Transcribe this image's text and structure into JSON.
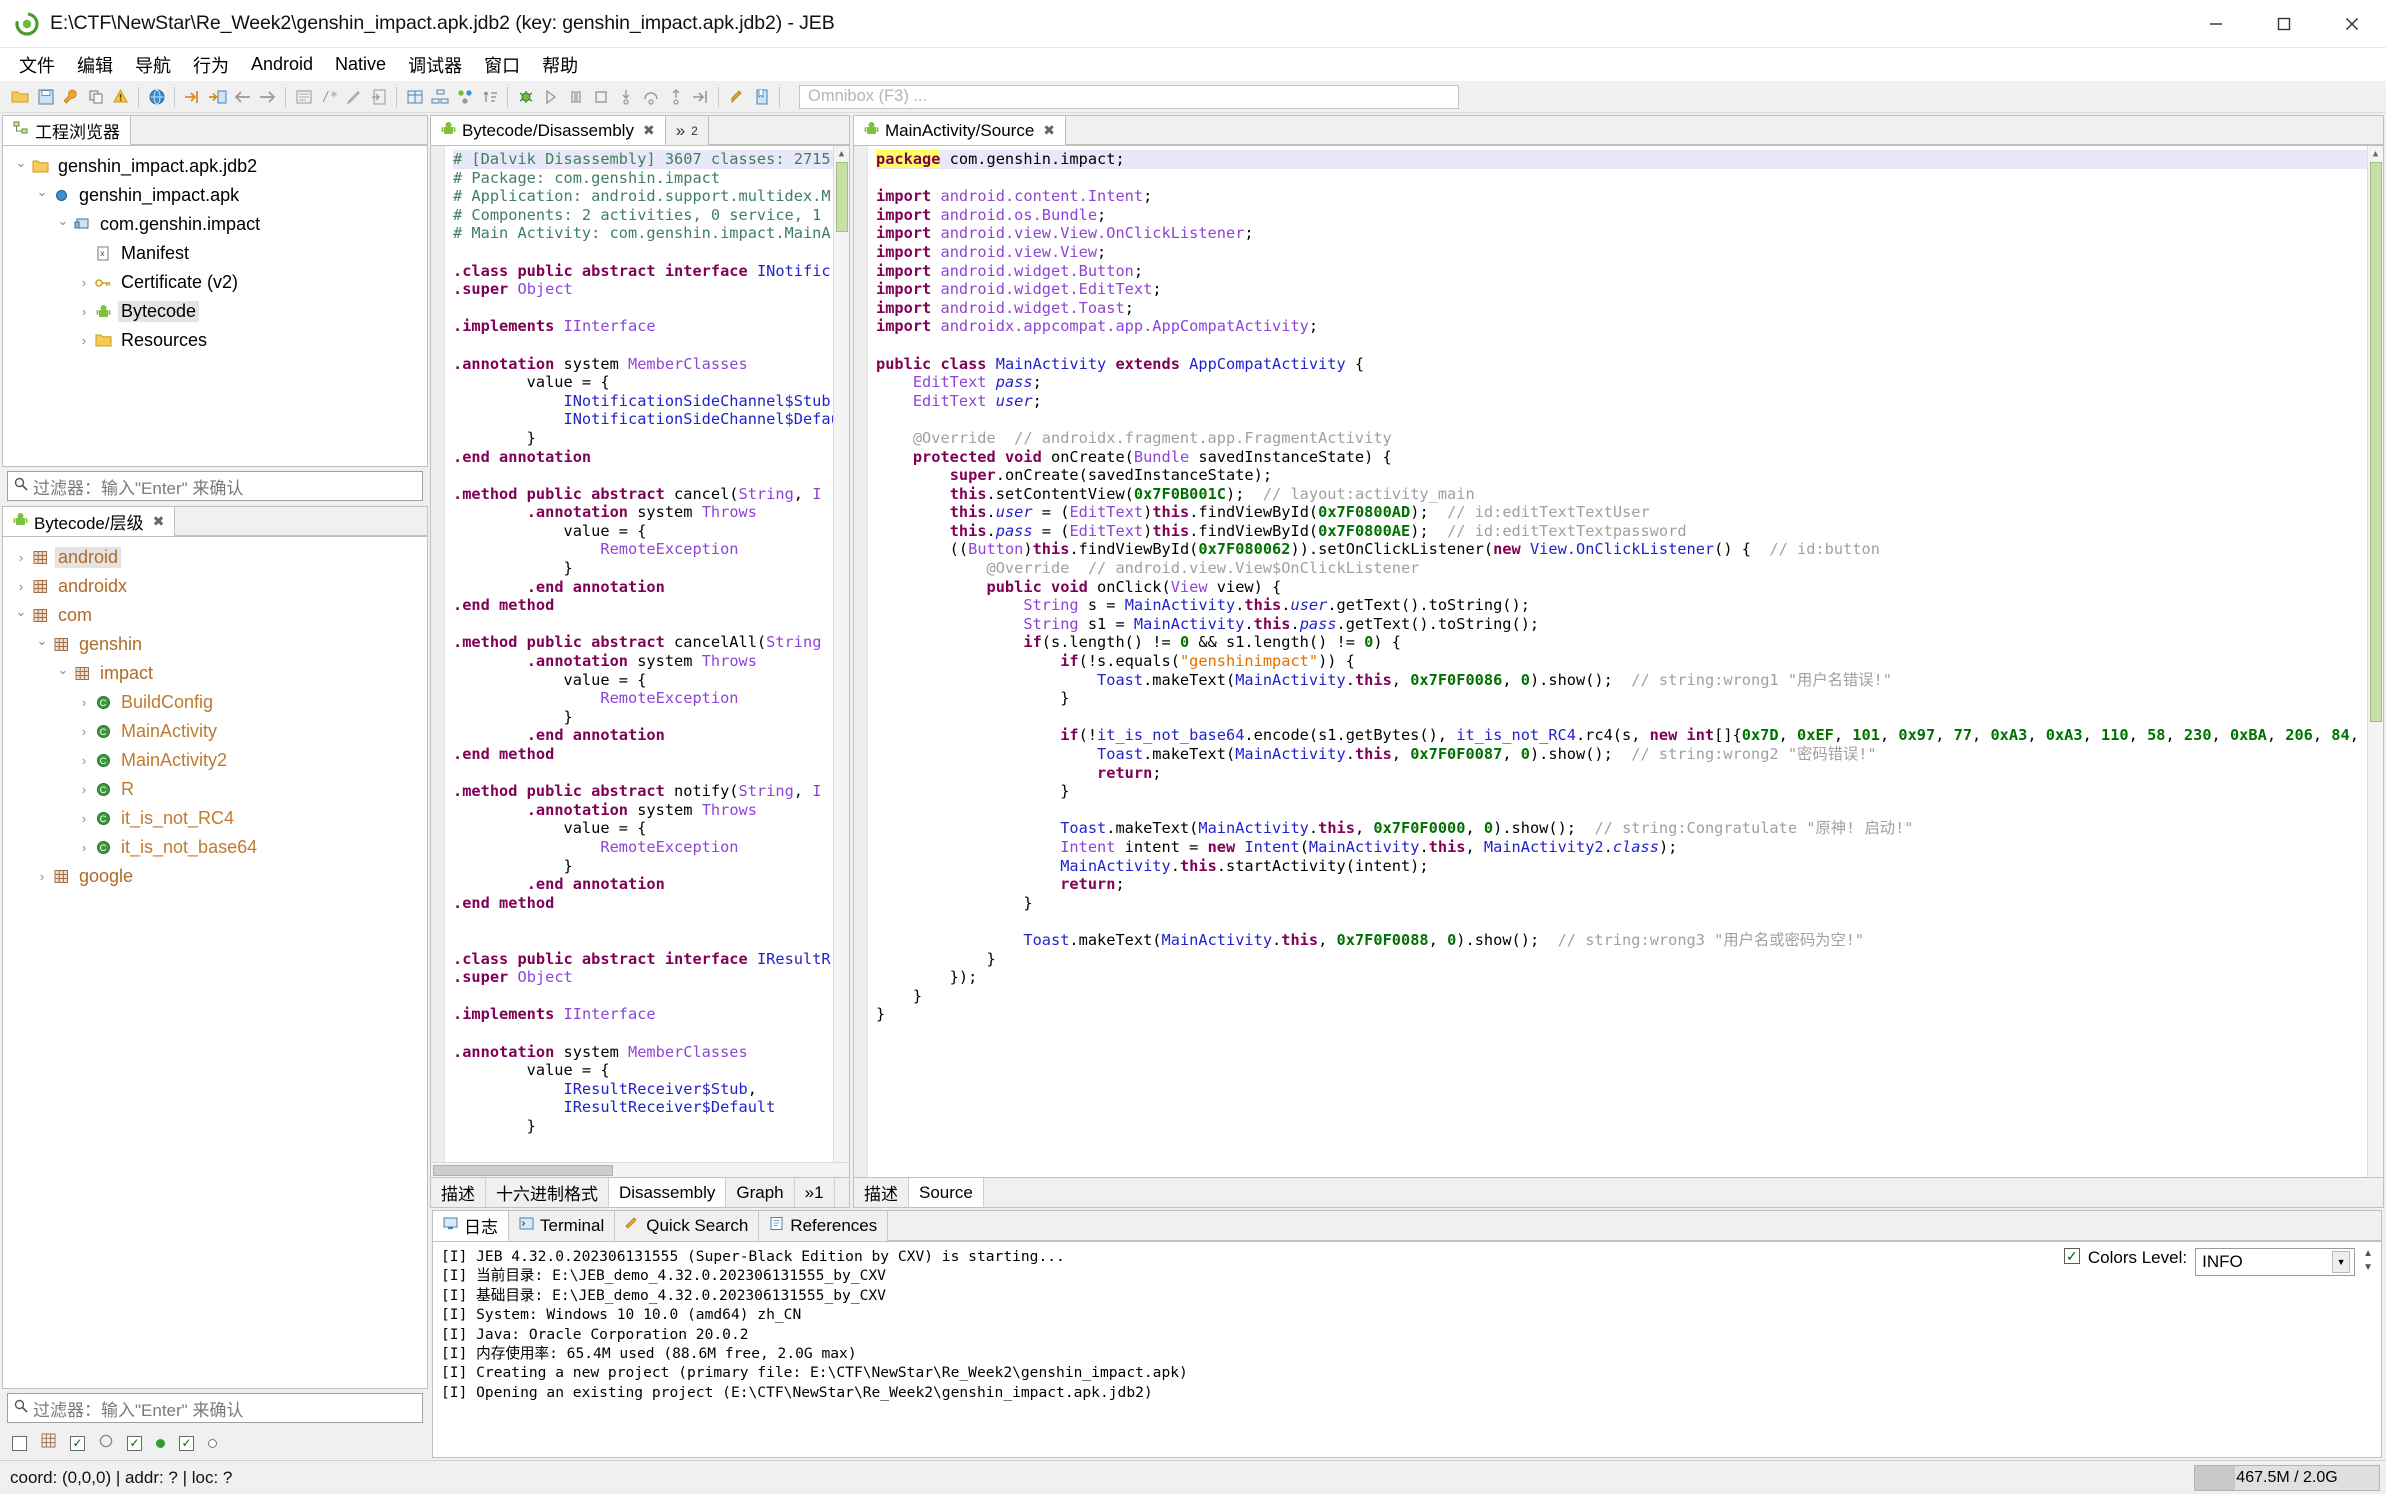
{
  "window": {
    "title": "E:\\CTF\\NewStar\\Re_Week2\\genshin_impact.apk.jdb2 (key: genshin_impact.apk.jdb2) - JEB",
    "minimize": "─",
    "maximize": "☐",
    "close": "✕"
  },
  "menu": [
    "文件",
    "编辑",
    "导航",
    "行为",
    "Android",
    "Native",
    "调试器",
    "窗口",
    "帮助"
  ],
  "toolbar": {
    "omnibox_placeholder": "Omnibox (F3) ..."
  },
  "project_explorer": {
    "tab_label": "工程浏览器",
    "filter_placeholder": "过滤器：输入\"Enter\" 来确认",
    "items": [
      {
        "label": "genshin_impact.apk.jdb2",
        "depth": 0,
        "arrow": "open",
        "icon": "folder-icon",
        "selected": false
      },
      {
        "label": "genshin_impact.apk",
        "depth": 1,
        "arrow": "open",
        "icon": "sphere-icon",
        "selected": false
      },
      {
        "label": "com.genshin.impact",
        "depth": 2,
        "arrow": "open",
        "icon": "dex-icon",
        "selected": false
      },
      {
        "label": "Manifest",
        "depth": 3,
        "arrow": "none",
        "icon": "xml-icon",
        "selected": false
      },
      {
        "label": "Certificate (v2)",
        "depth": 3,
        "arrow": "closed",
        "icon": "key-icon",
        "selected": false
      },
      {
        "label": "Bytecode",
        "depth": 3,
        "arrow": "closed",
        "icon": "android-icon",
        "selected": true
      },
      {
        "label": "Resources",
        "depth": 3,
        "arrow": "closed",
        "icon": "folder-icon",
        "selected": false
      }
    ]
  },
  "hierarchy": {
    "tab_label": "Bytecode/层级",
    "filter_placeholder": "过滤器：输入\"Enter\" 来确认",
    "items": [
      {
        "label": "android",
        "depth": 0,
        "arrow": "closed",
        "icon": "package-icon",
        "kind": "pkg",
        "selected": true
      },
      {
        "label": "androidx",
        "depth": 0,
        "arrow": "closed",
        "icon": "package-icon",
        "kind": "pkg",
        "selected": false
      },
      {
        "label": "com",
        "depth": 0,
        "arrow": "open",
        "icon": "package-icon",
        "kind": "pkg",
        "selected": false
      },
      {
        "label": "genshin",
        "depth": 1,
        "arrow": "open",
        "icon": "package-icon",
        "kind": "pkg",
        "selected": false
      },
      {
        "label": "impact",
        "depth": 2,
        "arrow": "open",
        "icon": "package-icon",
        "kind": "pkg",
        "selected": false
      },
      {
        "label": "BuildConfig",
        "depth": 3,
        "arrow": "closed",
        "icon": "class-icon",
        "kind": "cls",
        "selected": false
      },
      {
        "label": "MainActivity",
        "depth": 3,
        "arrow": "closed",
        "icon": "class-icon",
        "kind": "cls",
        "selected": false
      },
      {
        "label": "MainActivity2",
        "depth": 3,
        "arrow": "closed",
        "icon": "class-icon",
        "kind": "cls",
        "selected": false
      },
      {
        "label": "R",
        "depth": 3,
        "arrow": "closed",
        "icon": "class-icon",
        "kind": "cls",
        "selected": false
      },
      {
        "label": "it_is_not_RC4",
        "depth": 3,
        "arrow": "closed",
        "icon": "class-icon",
        "kind": "cls",
        "selected": false
      },
      {
        "label": "it_is_not_base64",
        "depth": 3,
        "arrow": "closed",
        "icon": "class-icon",
        "kind": "cls",
        "selected": false
      },
      {
        "label": "google",
        "depth": 1,
        "arrow": "closed",
        "icon": "package-icon",
        "kind": "pkg",
        "selected": false
      }
    ]
  },
  "disassembly_editor": {
    "tab_label": "Bytecode/Disassembly",
    "tab_overflow": "»",
    "tab_overflow_count": "2",
    "bottom_tabs": [
      "描述",
      "十六进制格式",
      "Disassembly",
      "Graph"
    ],
    "bottom_tabs_active": "Disassembly",
    "bottom_overflow": "»1"
  },
  "source_editor": {
    "tab_label": "MainActivity/Source",
    "bottom_tabs": [
      "描述",
      "Source"
    ],
    "bottom_tabs_active": "Source"
  },
  "console": {
    "tabs": [
      {
        "label": "日志",
        "icon": "console-icon",
        "active": true
      },
      {
        "label": "Terminal",
        "icon": "terminal-icon",
        "active": false
      },
      {
        "label": "Quick Search",
        "icon": "search-icon",
        "active": false
      },
      {
        "label": "References",
        "icon": "references-icon",
        "active": false
      }
    ],
    "colors_level_label": "Colors Level:",
    "colors_level_checked": true,
    "level_value": "INFO",
    "lines": [
      "[I] JEB 4.32.0.202306131555 (Super-Black Edition by CXV) is starting...",
      "[I] 当前目录: E:\\JEB_demo_4.32.0.202306131555_by_CXV",
      "[I] 基础目录: E:\\JEB_demo_4.32.0.202306131555_by_CXV",
      "[I] System: Windows 10 10.0 (amd64) zh_CN",
      "[I] Java: Oracle Corporation 20.0.2",
      "[I] 内存使用率: 65.4M used (88.6M free, 2.0G max)",
      "[I] Creating a new project (primary file: E:\\CTF\\NewStar\\Re_Week2\\genshin_impact.apk)",
      "[I] Opening an existing project (E:\\CTF\\NewStar\\Re_Week2\\genshin_impact.apk.jdb2)"
    ]
  },
  "statusbar": {
    "coords": "coord: (0,0,0) | addr: ? | loc: ?",
    "memory": "467.5M / 2.0G"
  }
}
